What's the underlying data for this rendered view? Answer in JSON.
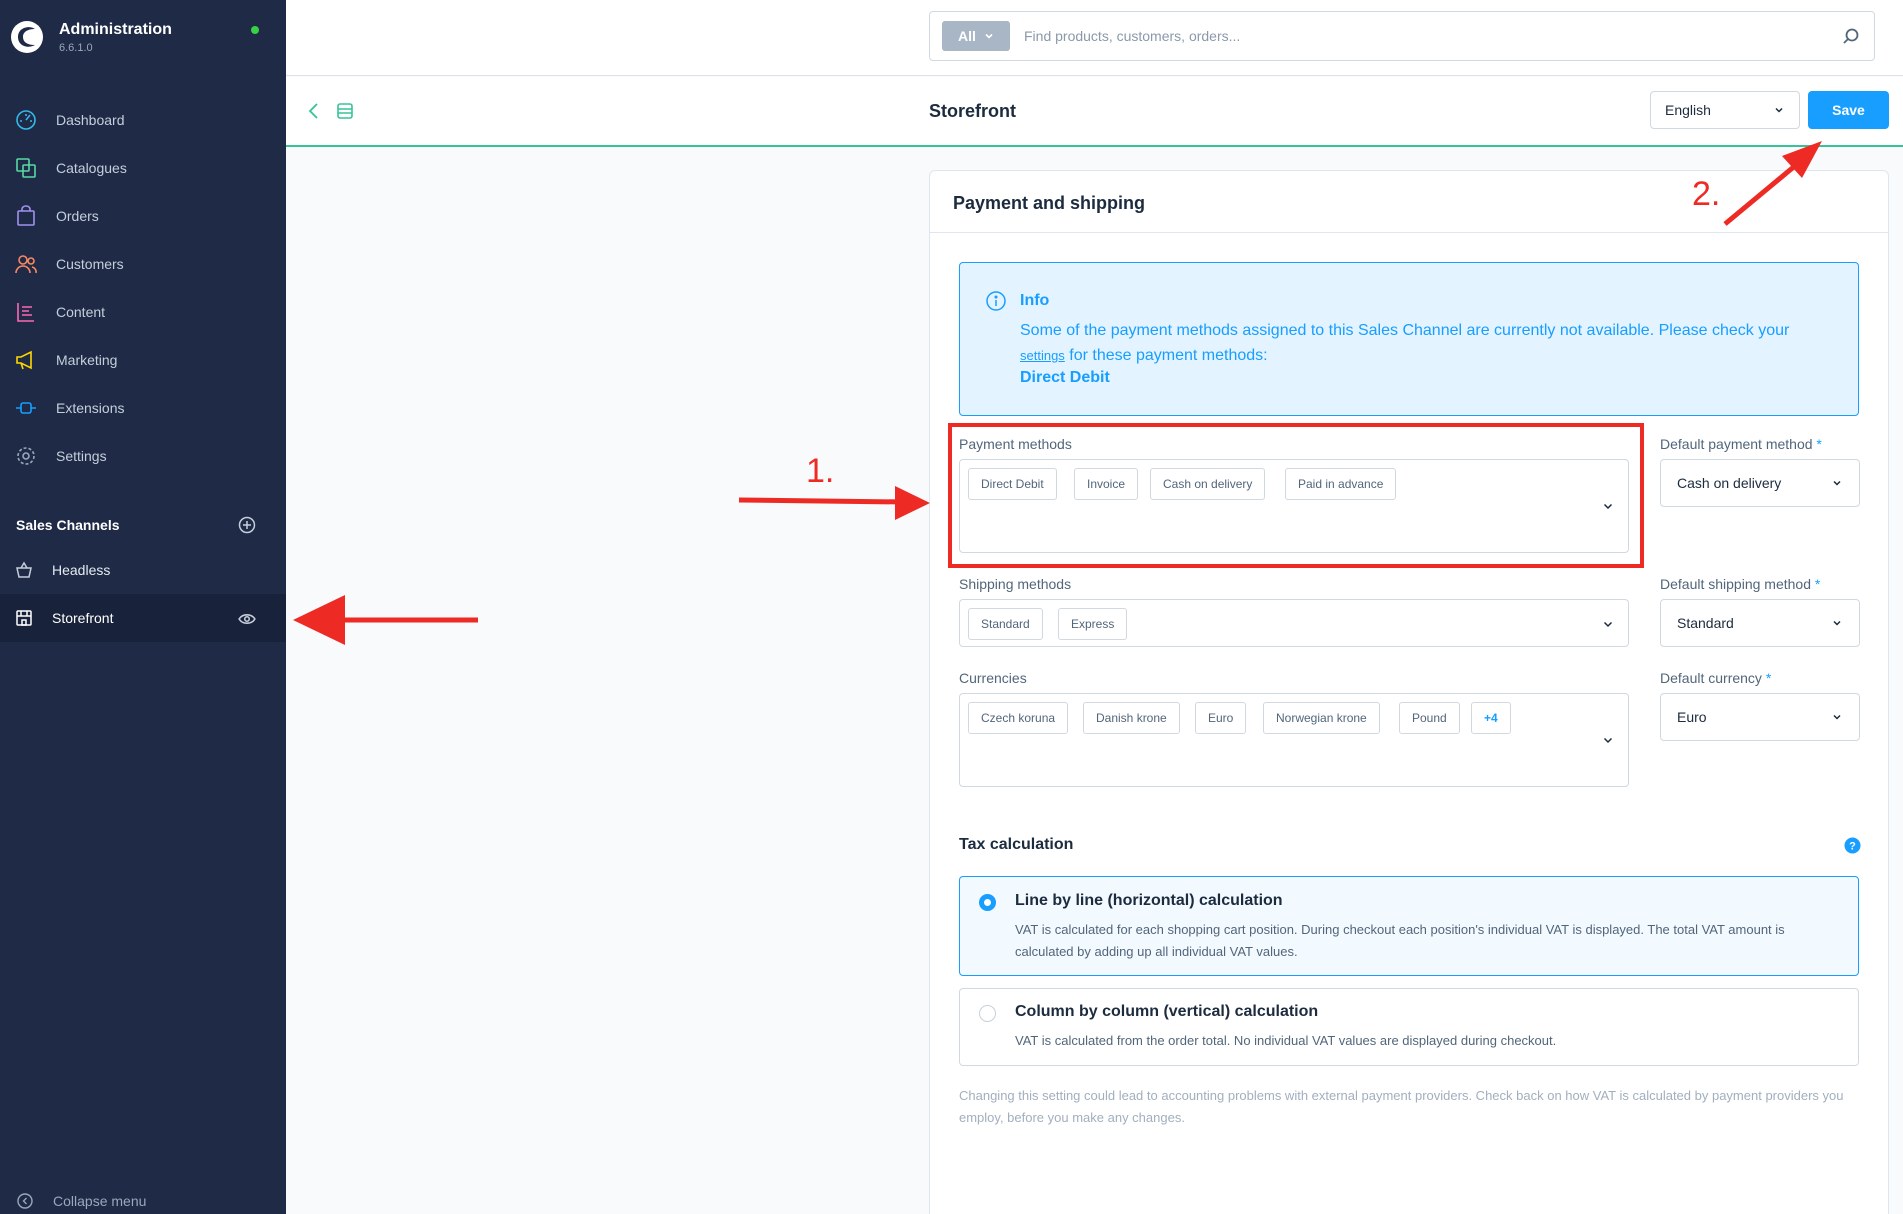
{
  "app": {
    "title": "Administration",
    "version": "6.6.1.0"
  },
  "nav": [
    {
      "label": "Dashboard",
      "icon": "dashboard-icon",
      "color": "#35b7e8"
    },
    {
      "label": "Catalogues",
      "icon": "catalogues-icon",
      "color": "#57d9a3"
    },
    {
      "label": "Orders",
      "icon": "orders-icon",
      "color": "#a092f0"
    },
    {
      "label": "Customers",
      "icon": "customers-icon",
      "color": "#f88962"
    },
    {
      "label": "Content",
      "icon": "content-icon",
      "color": "#ff68b4"
    },
    {
      "label": "Marketing",
      "icon": "marketing-icon",
      "color": "#ffd700"
    },
    {
      "label": "Extensions",
      "icon": "extensions-icon",
      "color": "#189eff"
    },
    {
      "label": "Settings",
      "icon": "settings-icon",
      "color": "#9aa8b5"
    }
  ],
  "sales_channels": {
    "title": "Sales Channels",
    "items": [
      {
        "label": "Headless",
        "icon": "basket-icon"
      },
      {
        "label": "Storefront",
        "icon": "storefront-icon"
      }
    ]
  },
  "collapse_label": "Collapse menu",
  "search": {
    "filter": "All",
    "placeholder": "Find products, customers, orders..."
  },
  "smartbar": {
    "title": "Storefront",
    "language": "English",
    "save_label": "Save"
  },
  "card": {
    "title": "Payment and shipping",
    "info": {
      "title": "Info",
      "text_before": "Some of the payment methods assigned to this Sales Channel are currently not available. Please check your ",
      "link": "settings",
      "text_after": " for these payment methods:",
      "strong": "Direct Debit"
    },
    "payment": {
      "label": "Payment methods",
      "tags": [
        "Direct Debit",
        "Invoice",
        "Cash on delivery",
        "Paid in advance"
      ],
      "default_label": "Default payment method",
      "default_value": "Cash on delivery"
    },
    "shipping": {
      "label": "Shipping methods",
      "tags": [
        "Standard",
        "Express"
      ],
      "default_label": "Default shipping method",
      "default_value": "Standard"
    },
    "currencies": {
      "label": "Currencies",
      "tags": [
        "Czech koruna",
        "Danish krone",
        "Euro",
        "Norwegian krone",
        "Pound"
      ],
      "more": "+4",
      "default_label": "Default currency",
      "default_value": "Euro"
    },
    "required_mark": "*",
    "tax": {
      "title": "Tax calculation",
      "options": [
        {
          "title": "Line by line (horizontal) calculation",
          "desc": "VAT is calculated for each shopping cart position. During checkout each position's individual VAT is displayed. The total VAT amount is calculated by adding up all individual VAT values.",
          "selected": true
        },
        {
          "title": "Column by column (vertical) calculation",
          "desc": "VAT is calculated from the order total. No individual VAT values are displayed during checkout.",
          "selected": false
        }
      ],
      "help": "Changing this setting could lead to accounting problems with external payment providers. Check back on how VAT is calculated by payment providers you employ, before you make any changes."
    }
  },
  "annotations": {
    "step1": "1.",
    "step2": "2."
  },
  "colors": {
    "sidebar": "#1e2a46",
    "primary": "#189eff",
    "accent": "#37c39a",
    "annotation": "#ed2b24"
  }
}
